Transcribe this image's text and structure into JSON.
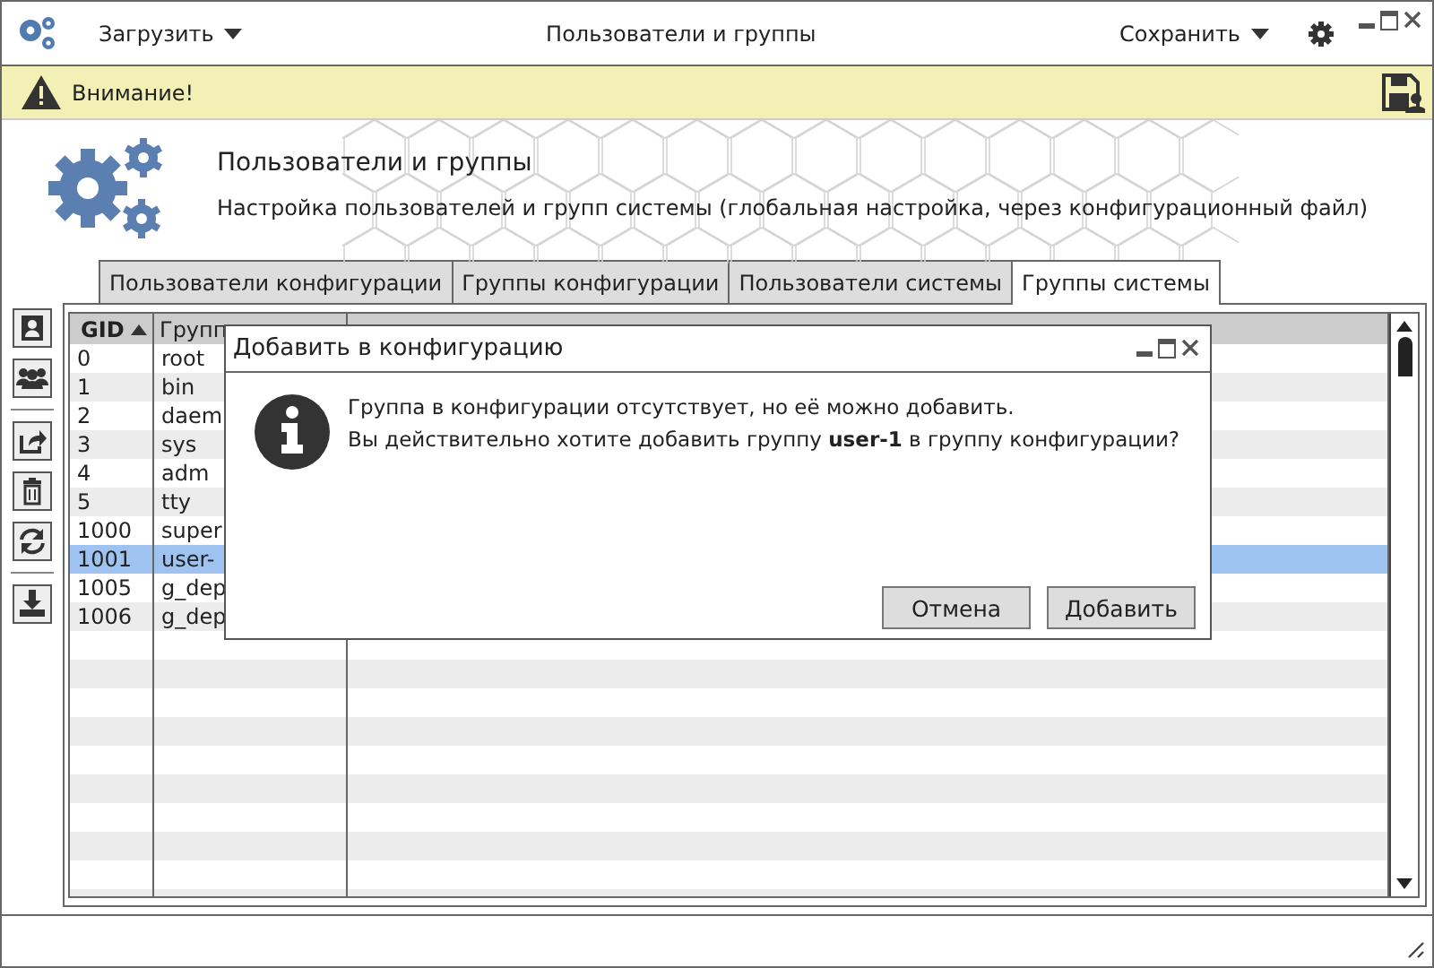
{
  "window": {
    "title": "Пользователи и группы"
  },
  "menus": {
    "load": "Загрузить",
    "save": "Сохранить"
  },
  "warning": {
    "text": "Внимание!"
  },
  "header": {
    "title": "Пользователи и группы",
    "subtitle": "Настройка пользователей и групп системы (глобальная настройка, через конфигурационный файл)"
  },
  "tabs": [
    {
      "label": "Пользователи конфигурации",
      "selected": false
    },
    {
      "label": "Группы конфигурации",
      "selected": false
    },
    {
      "label": "Пользователи системы",
      "selected": false
    },
    {
      "label": "Группы системы",
      "selected": true
    }
  ],
  "table": {
    "columns": [
      {
        "label": "GID",
        "sorted": true
      },
      {
        "label": "Групп",
        "sorted": false
      }
    ],
    "rows": [
      {
        "gid": "0",
        "group": "root",
        "selected": false
      },
      {
        "gid": "1",
        "group": "bin",
        "selected": false
      },
      {
        "gid": "2",
        "group": "daem",
        "selected": false
      },
      {
        "gid": "3",
        "group": "sys",
        "selected": false
      },
      {
        "gid": "4",
        "group": "adm",
        "selected": false
      },
      {
        "gid": "5",
        "group": "tty",
        "selected": false
      },
      {
        "gid": "1000",
        "group": "super",
        "selected": false
      },
      {
        "gid": "1001",
        "group": "user-",
        "selected": true
      },
      {
        "gid": "1005",
        "group": "g_dep",
        "selected": false
      },
      {
        "gid": "1006",
        "group": "g_dep",
        "selected": false
      }
    ]
  },
  "dialog": {
    "title": "Добавить в конфигурацию",
    "message": [
      "Группа в конфигурации отсутствует, но её можно добавить.",
      "Вы действительно хотите добавить группу **user-1** в группу конфигурации?"
    ],
    "buttons": [
      "Отмена",
      "Добавить"
    ]
  }
}
